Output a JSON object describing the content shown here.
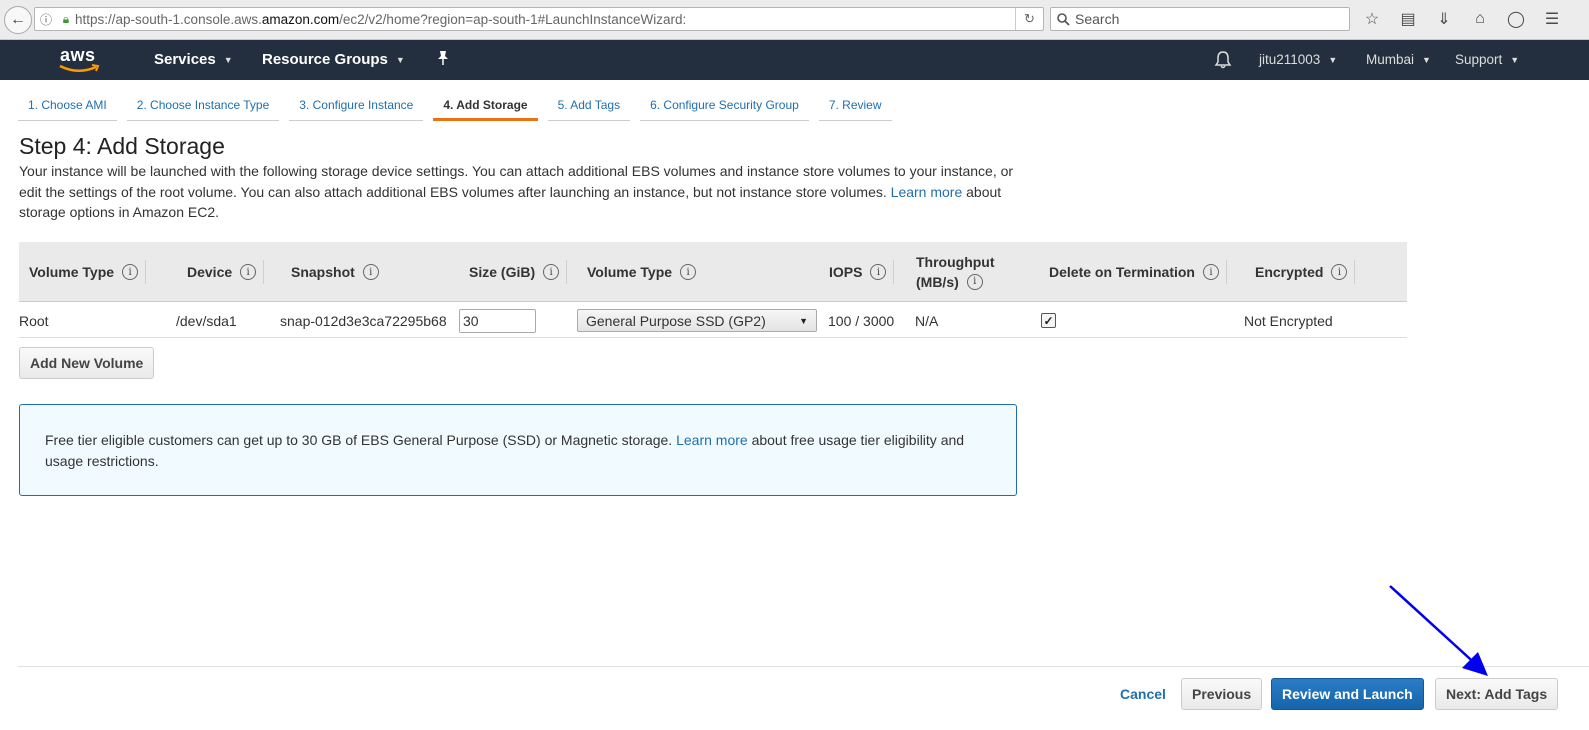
{
  "browser": {
    "url_prefix": "https://ap-south-1.console.aws.",
    "url_domain": "amazon.com",
    "url_suffix": "/ec2/v2/home?region=ap-south-1#LaunchInstanceWizard:",
    "search_placeholder": "Search",
    "icons": [
      "back-arrow-icon",
      "info-icon",
      "lock-icon",
      "reload-icon",
      "search-icon",
      "star-icon",
      "reader-icon",
      "download-icon",
      "home-icon",
      "pocket-icon",
      "menu-icon"
    ]
  },
  "aws_nav": {
    "logo_text": "aws",
    "services": "Services",
    "resource_groups": "Resource Groups",
    "user": "jitu211003",
    "region": "Mumbai",
    "support": "Support"
  },
  "wizard": {
    "tabs": [
      {
        "label": "1. Choose AMI"
      },
      {
        "label": "2. Choose Instance Type"
      },
      {
        "label": "3. Configure Instance"
      },
      {
        "label": "4. Add Storage",
        "active": true
      },
      {
        "label": "5. Add Tags"
      },
      {
        "label": "6. Configure Security Group"
      },
      {
        "label": "7. Review"
      }
    ],
    "title": "Step 4: Add Storage",
    "desc_part1": "Your instance will be launched with the following storage device settings. You can attach additional EBS volumes and instance store volumes to your instance, or edit the settings of the root volume. You can also attach additional EBS volumes after launching an instance, but not instance store volumes.",
    "desc_link": "Learn more",
    "desc_part2": "about storage options in Amazon EC2."
  },
  "table": {
    "headers": [
      "Volume Type",
      "Device",
      "Snapshot",
      "Size (GiB)",
      "Volume Type",
      "IOPS",
      "Throughput (MB/s)",
      "Delete on Termination",
      "Encrypted"
    ],
    "throughput_line1": "Throughput",
    "throughput_line2": "(MB/s)",
    "row": {
      "volume_type": "Root",
      "device": "/dev/sda1",
      "snapshot": "snap-012d3e3ca72295b68",
      "size": "30",
      "volume_type_select": "General Purpose SSD (GP2)",
      "iops": "100 / 3000",
      "throughput": "N/A",
      "delete_on_termination": true,
      "encrypted": "Not Encrypted"
    },
    "add_volume_label": "Add New Volume"
  },
  "info": {
    "text1": "Free tier eligible customers can get up to 30 GB of EBS General Purpose (SSD) or Magnetic storage.",
    "link": "Learn more",
    "text2": "about free usage tier eligibility and usage restrictions."
  },
  "footer": {
    "cancel": "Cancel",
    "previous": "Previous",
    "review_launch": "Review and Launch",
    "next": "Next: Add Tags"
  },
  "colors": {
    "aws_nav_bg": "#232f3e",
    "link": "#1f6fb0",
    "active_tab": "#ec7211",
    "primary_button": "#1f6fb0",
    "annotation_arrow": "#0000ee"
  }
}
